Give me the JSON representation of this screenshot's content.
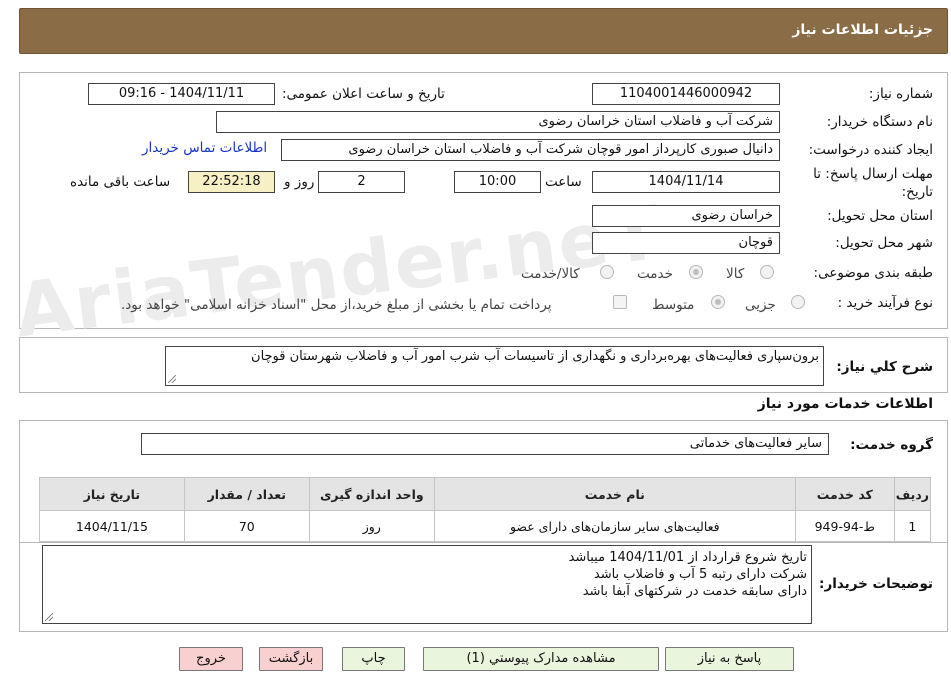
{
  "header": {
    "title": "جزئیات اطلاعات نیاز"
  },
  "watermark": {
    "text": "AriaTender.neT"
  },
  "form": {
    "need_number_label": "شماره نیاز:",
    "need_number": "1104001446000942",
    "announce_label": "تاریخ و ساعت اعلان عمومی:",
    "announce_value": "1404/11/11 - 09:16",
    "buyer_org_label": "نام دستگاه خریدار:",
    "buyer_org": "شرکت آب و فاضلاب استان خراسان رضوی",
    "creator_label": "ایجاد کننده درخواست:",
    "creator": "دانیال صبوری کارپرداز امور قوچان  شرکت آب و فاضلاب استان خراسان رضوی",
    "contact_link": "اطلاعات تماس خریدار",
    "deadline_label_1": "مهلت ارسال پاسخ: تا",
    "deadline_label_2": "تاریخ:",
    "deadline_date": "1404/11/14",
    "time_label": "ساعت",
    "deadline_time": "10:00",
    "days_value": "2",
    "days_label": "روز و",
    "remaining_time": "22:52:18",
    "remaining_label": "ساعت باقی مانده",
    "province_label": "استان محل تحویل:",
    "province": "خراسان رضوی",
    "city_label": "شهر محل تحویل:",
    "city": "قوچان",
    "category_label": "طبقه بندی موضوعی:",
    "category_options": [
      "کالا",
      "خدمت",
      "کالا/خدمت"
    ],
    "category_selected": "خدمت",
    "process_label": "نوع فرآیند خرید :",
    "process_options": [
      "جزیی",
      "متوسط"
    ],
    "process_selected": "متوسط",
    "payment_note": "پرداخت تمام یا بخشی از مبلغ خرید،از محل \"اسناد خزانه اسلامی\" خواهد بود."
  },
  "description": {
    "label": "شرح کلي نياز:",
    "text": "برون‌سپاری فعالیت‌های بهره‌برداری و نگهداری از تاسیسات آب شرب امور آب و فاضلاب شهرستان قوچان"
  },
  "services": {
    "section_title": "اطلاعات خدمات مورد نياز",
    "group_label": "گروه خدمت:",
    "group_value": "سایر فعالیت‌های خدماتی",
    "columns": [
      "ردیف",
      "کد خدمت",
      "نام خدمت",
      "واحد اندازه گیری",
      "تعداد / مقدار",
      "تاریخ نیاز"
    ],
    "rows": [
      [
        "1",
        "ط-94-949",
        "فعالیت‌های سایر سازمان‌های دارای عضو",
        "روز",
        "70",
        "1404/11/15"
      ]
    ]
  },
  "buyer_notes": {
    "label": "توضیحات خریدار:",
    "line1": "تاریخ شروع قرارداد از 1404/11/01 میباشد",
    "line2": "شرکت دارای رتبه 5 آب و فاضلاب باشد",
    "line3": "دارای سابقه خدمت در شرکتهای آبفا باشد"
  },
  "buttons": {
    "reply": "پاسخ به نیاز",
    "attachments": "مشاهده مدارک پیوستي (1)",
    "print": "چاپ",
    "back": "بازگشت",
    "exit": "خروج"
  },
  "colors": {
    "header_bg": "#8a6d46",
    "button_green": "#e9f6dd",
    "button_pink": "#f9d0d0",
    "link": "#1a34c7",
    "remaining_bg": "#f6f0c4"
  }
}
